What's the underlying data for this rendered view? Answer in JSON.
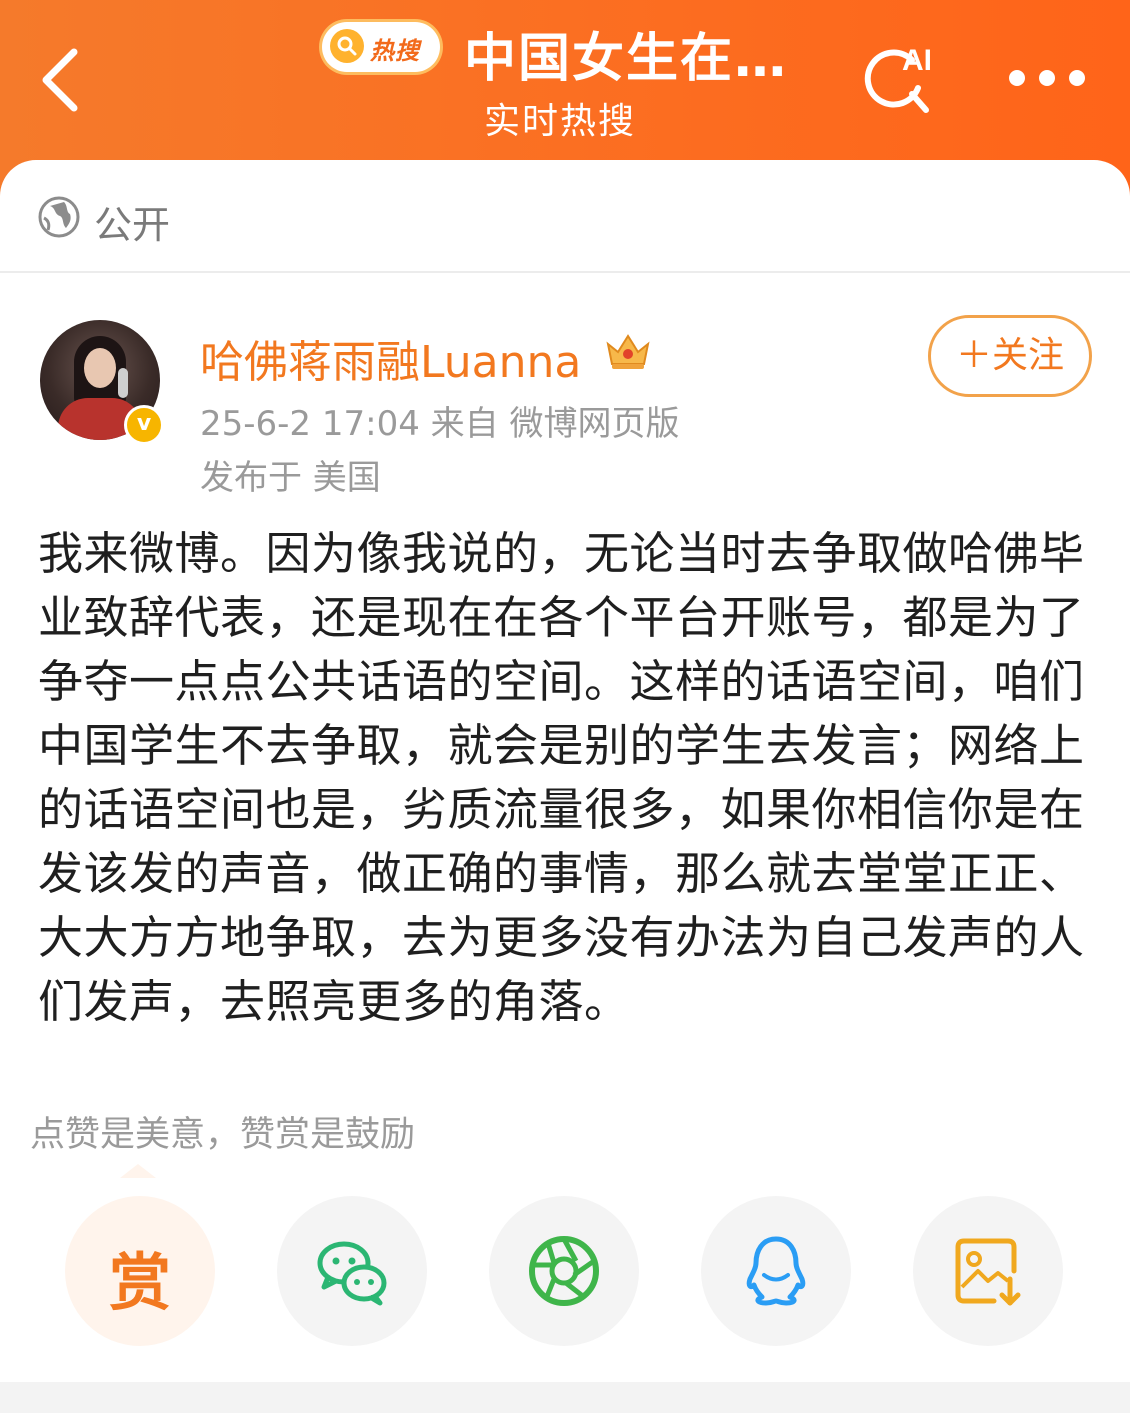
{
  "colors": {
    "brand_orange": "#fb6f22",
    "name_orange": "#f2781f",
    "meta_gray": "#9a9a9a",
    "text_dark": "#1f1f1f"
  },
  "header": {
    "back_icon": "chevron-left-icon",
    "hot_badge_label": "热搜",
    "title": "中国女生在…",
    "subtitle": "实时热搜",
    "ai_search_icon": "ai-search-icon",
    "ai_label": "AI",
    "more_icon": "more-dots-icon"
  },
  "visibility": {
    "icon": "globe-icon",
    "label": "公开"
  },
  "post": {
    "author": {
      "name": "哈佛蒋雨融Luanna",
      "verified_mark": "v",
      "avatar_icon": "avatar"
    },
    "follow_label": "＋关注",
    "meta": "25-6-2 17:04  来自 微博网页版",
    "location": "发布于 美国",
    "body": "我来微博。因为像我说的，无论当时去争取做哈佛毕业致辞代表，还是现在在各个平台开账号，都是为了争夺一点点公共话语的空间。这样的话语空间，咱们中国学生不去争取，就会是别的学生去发言；网络上的话语空间也是，劣质流量很多，如果你相信你是在发该发的声音，做正确的事情，那么就去堂堂正正、大大方方地争取，去为更多没有办法为自己发声的人们发声，去照亮更多的角落。"
  },
  "reward": {
    "hint": "点赞是美意，赞赏是鼓励",
    "reward_label": "赏"
  },
  "share": [
    {
      "name": "reward",
      "icon": "reward-icon"
    },
    {
      "name": "wechat",
      "icon": "wechat-icon"
    },
    {
      "name": "moments",
      "icon": "wechat-moments-icon"
    },
    {
      "name": "qq",
      "icon": "qq-icon"
    },
    {
      "name": "save-image",
      "icon": "save-image-icon"
    }
  ]
}
